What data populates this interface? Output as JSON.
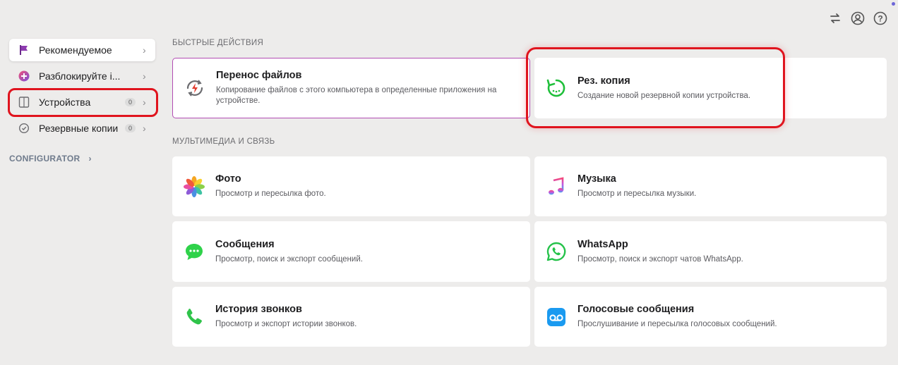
{
  "toolbar": {
    "transfer_icon": "arrows-exchange-icon",
    "account_icon": "user-circle-icon",
    "help_icon": "question-circle-icon"
  },
  "sidebar": {
    "items": [
      {
        "label": "Рекомендуемое",
        "icon": "flag-icon"
      },
      {
        "label": "Разблокируйте i...",
        "icon": "unlock-icon"
      },
      {
        "label": "Устройства",
        "icon": "devices-icon",
        "badge": "0"
      },
      {
        "label": "Резервные копии",
        "icon": "backup-clock-icon",
        "badge": "0"
      }
    ],
    "configurator": "CONFIGURATOR"
  },
  "quick_actions": {
    "title": "БЫСТРЫЕ ДЕЙСТВИЯ",
    "cards": [
      {
        "title": "Перенос файлов",
        "desc": "Копирование файлов с этого компьютера в определенные приложения на устройстве.",
        "icon": "file-transfer-icon"
      },
      {
        "title": "Рез. копия",
        "desc": "Создание новой резервной копии устройства.",
        "icon": "backup-icon"
      }
    ]
  },
  "media": {
    "title": "МУЛЬТИМЕДИА И СВЯЗЬ",
    "cards": [
      {
        "title": "Фото",
        "desc": "Просмотр и пересылка фото.",
        "icon": "photos-icon"
      },
      {
        "title": "Музыка",
        "desc": "Просмотр и пересылка музыки.",
        "icon": "music-icon"
      },
      {
        "title": "Сообщения",
        "desc": "Просмотр, поиск и экспорт сообщений.",
        "icon": "messages-icon"
      },
      {
        "title": "WhatsApp",
        "desc": "Просмотр, поиск и экспорт чатов WhatsApp.",
        "icon": "whatsapp-icon"
      },
      {
        "title": "История звонков",
        "desc": "Просмотр и экспорт истории звонков.",
        "icon": "phone-icon"
      },
      {
        "title": "Голосовые сообщения",
        "desc": "Прослушивание и пересылка голосовых сообщений.",
        "icon": "voicemail-icon"
      }
    ]
  },
  "colors": {
    "highlight": "#e0141e",
    "transfer_border": "#b24cb3",
    "accent_green": "#1fbf3a"
  }
}
